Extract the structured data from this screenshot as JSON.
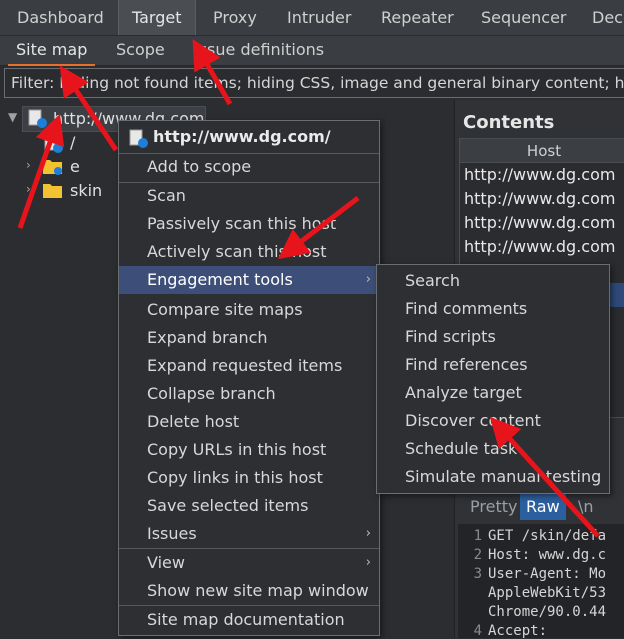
{
  "topnav": {
    "tabs": [
      "Dashboard",
      "Target",
      "Proxy",
      "Intruder",
      "Repeater",
      "Sequencer",
      "Deco"
    ],
    "active": "Target"
  },
  "subnav": {
    "tabs": [
      "Site map",
      "Scope",
      "Issue definitions"
    ],
    "active": "Site map"
  },
  "filter": {
    "text": "Filter: Hiding not found items;  hiding CSS, image and general binary content;  h"
  },
  "tree": {
    "root": "http://www.dg.com",
    "children": [
      "/",
      "e",
      "skin"
    ]
  },
  "contents": {
    "title": "Contents",
    "column": "Host",
    "rows": [
      "http://www.dg.com",
      "http://www.dg.com",
      "http://www.dg.com",
      "http://www.dg.com"
    ]
  },
  "context_menu": {
    "header": "http://www.dg.com/",
    "items": [
      "Add to scope",
      "Scan",
      "Passively scan this host",
      "Actively scan this host",
      "Engagement tools",
      "Compare site maps",
      "Expand branch",
      "Expand requested items",
      "Collapse branch",
      "Delete host",
      "Copy URLs in this host",
      "Copy links in this host",
      "Save selected items",
      "Issues",
      "View",
      "Show new site map window",
      "Site map documentation"
    ]
  },
  "engagement_submenu": {
    "items": [
      "Search",
      "Find comments",
      "Find scripts",
      "Find references",
      "Analyze target",
      "Discover content",
      "Schedule task",
      "Simulate manual testing"
    ]
  },
  "request": {
    "tabs": [
      "Pretty",
      "Raw",
      "\\n"
    ],
    "active": "Raw",
    "lines": [
      {
        "n": "1",
        "text": "GET /skin/defa"
      },
      {
        "n": "2",
        "text": "Host: www.dg.c"
      },
      {
        "n": "3",
        "text": "User-Agent: Mo"
      },
      {
        "n": "",
        "text": "AppleWebKit/53"
      },
      {
        "n": "",
        "text": "Chrome/90.0.44"
      },
      {
        "n": "4",
        "text": "Accept:"
      }
    ]
  },
  "colors": {
    "accent": "#e8702a",
    "menu_highlight": "#3d4f78",
    "annotation": "#e8141c"
  }
}
